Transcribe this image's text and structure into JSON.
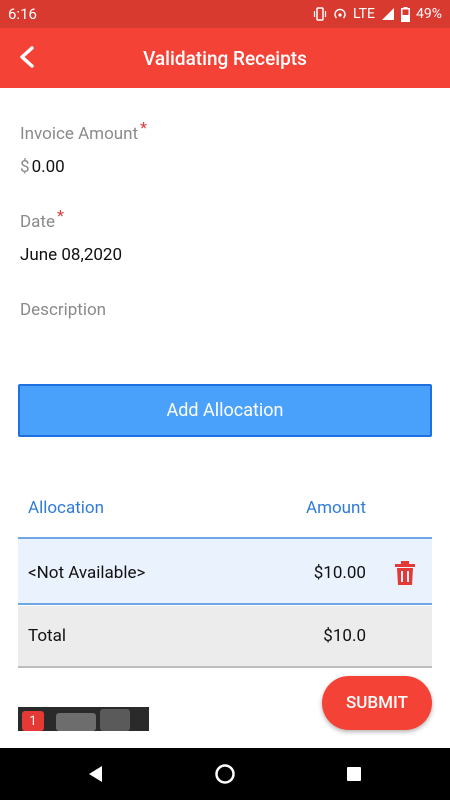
{
  "status_bar": {
    "time": "6:16",
    "network": "LTE",
    "battery": "49%"
  },
  "app_bar": {
    "title": "Validating Receipts",
    "back_icon": "arrow-back-icon"
  },
  "form": {
    "invoice_amount": {
      "label": "Invoice Amount",
      "required_mark": "*",
      "currency": "$",
      "value": "0.00"
    },
    "date": {
      "label": "Date",
      "required_mark": "*",
      "value": "June 08,2020"
    },
    "description": {
      "label": "Description",
      "value": ""
    }
  },
  "add_allocation_label": "Add Allocation",
  "allocations": {
    "headers": {
      "allocation": "Allocation",
      "amount": "Amount"
    },
    "rows": [
      {
        "allocation": "<Not Available>",
        "amount": "$10.00"
      }
    ],
    "total": {
      "label": "Total",
      "amount": "$10.0"
    }
  },
  "attachments": {
    "count": "1"
  },
  "submit_label": "SUBMIT",
  "colors": {
    "primary": "#f44336",
    "status_bar": "#d93a30",
    "accent_blue": "#4aa1fb",
    "header_blue": "#2f7bd8"
  }
}
